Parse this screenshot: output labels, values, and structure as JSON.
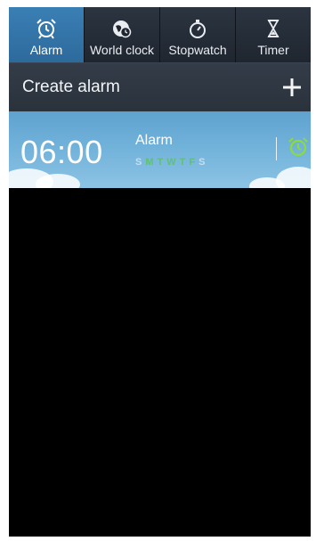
{
  "tabs": [
    {
      "label": "Alarm",
      "icon": "alarm-clock-icon",
      "active": true
    },
    {
      "label": "World clock",
      "icon": "globe-clock-icon",
      "active": false
    },
    {
      "label": "Stopwatch",
      "icon": "stopwatch-icon",
      "active": false
    },
    {
      "label": "Timer",
      "icon": "hourglass-icon",
      "active": false
    }
  ],
  "create_alarm": {
    "label": "Create alarm",
    "icon": "plus-icon"
  },
  "alarms": [
    {
      "time": "06:00",
      "name": "Alarm",
      "days": [
        "S",
        "M",
        "T",
        "W",
        "T",
        "F",
        "S"
      ],
      "active_days": [
        1,
        2,
        3,
        4,
        5
      ],
      "enabled": true,
      "toggle_icon": "alarm-clock-icon"
    }
  ],
  "colors": {
    "accent": "#2d6a9c",
    "toggle_green": "#8bdc3a",
    "day_on": "#5ec46a"
  }
}
